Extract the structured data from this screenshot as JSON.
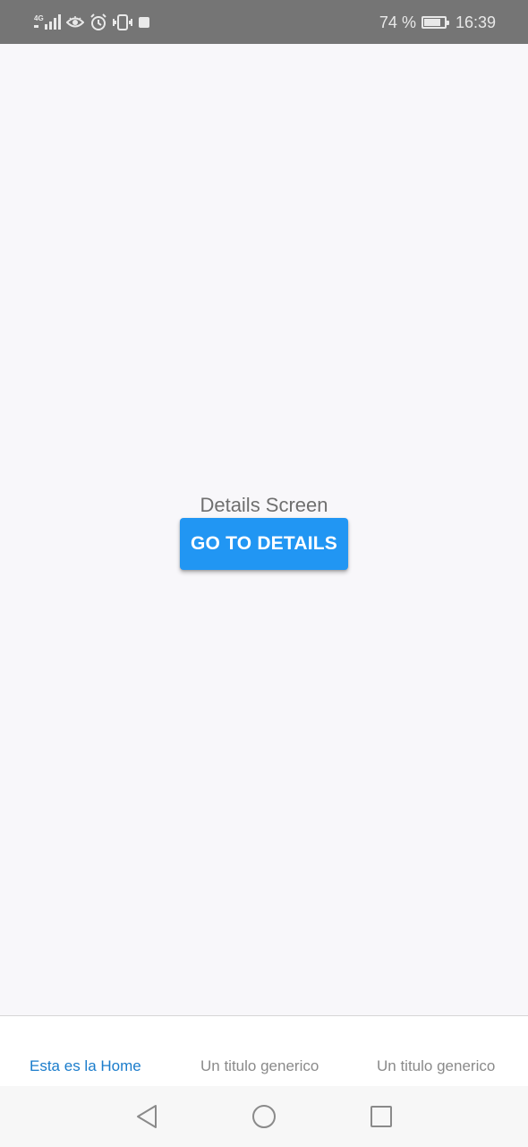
{
  "status_bar": {
    "network_label": "4G",
    "battery_percent_text": "74 %",
    "battery_level": 0.74,
    "time": "16:39",
    "icons": [
      "signal-icon",
      "eye-icon",
      "alarm-icon",
      "vibrate-icon",
      "notification-square-icon",
      "battery-charging-icon"
    ]
  },
  "main": {
    "screen_label": "Details Screen",
    "button_label": "GO TO DETAILS"
  },
  "tab_bar": {
    "tabs": [
      {
        "label": "Esta es la Home",
        "active": true
      },
      {
        "label": "Un titulo generico",
        "active": false
      },
      {
        "label": "Un titulo generico",
        "active": false
      }
    ]
  },
  "nav_bar": {
    "icons": [
      "back-icon",
      "home-icon",
      "recents-icon"
    ]
  },
  "colors": {
    "accent": "#2196f3",
    "tab_active": "#1a7ccb",
    "tab_inactive": "#8a8a8a",
    "status_bar_bg": "#757575",
    "background": "#f8f7fa"
  }
}
